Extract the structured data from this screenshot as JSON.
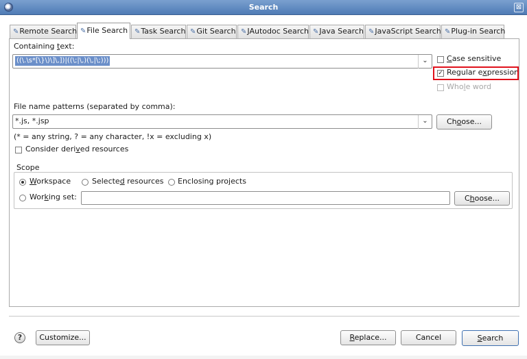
{
  "window": {
    "title": "Search",
    "close_glyph": "⊠"
  },
  "tabs": [
    {
      "label": "Remote Search",
      "icon": "remote-search-icon",
      "active": false
    },
    {
      "label": "File Search",
      "icon": "file-search-icon",
      "active": true
    },
    {
      "label": "Task Search",
      "icon": "task-search-icon",
      "active": false
    },
    {
      "label": "Git Search",
      "icon": "git-search-icon",
      "active": false
    },
    {
      "label": "JAutodoc Search",
      "icon": "jautodoc-search-icon",
      "active": false
    },
    {
      "label": "Java Search",
      "icon": "java-search-icon",
      "active": false
    },
    {
      "label": "JavaScript Search",
      "icon": "javascript-search-icon",
      "active": false
    },
    {
      "label": "Plug-in Search",
      "icon": "plugin-search-icon",
      "active": false
    }
  ],
  "containing": {
    "label_pre": "Containing ",
    "label_mnemonic": "t",
    "label_post": "ext:",
    "value": "((\\.\\s*[\\}\\)\\]\\,])|((\\;|\\,)(\\,|\\;)))"
  },
  "options": {
    "case_sensitive": {
      "pre": "",
      "mnemonic": "C",
      "post": "ase sensitive",
      "checked": false,
      "enabled": true
    },
    "regular_expression": {
      "pre": "Regular e",
      "mnemonic": "x",
      "post": "pression",
      "checked": true,
      "enabled": true
    },
    "whole_word": {
      "pre": "Who",
      "mnemonic": "l",
      "post": "e word",
      "checked": false,
      "enabled": false
    }
  },
  "file_patterns": {
    "label": "File name patterns (separated by comma):",
    "value": "*.js, *.jsp",
    "hint": "(* = any string, ? = any character, !x = excluding x)",
    "choose_pre": "Ch",
    "choose_mnemonic": "o",
    "choose_post": "ose..."
  },
  "derived": {
    "pre": "Consider deri",
    "mnemonic": "v",
    "post": "ed resources",
    "checked": false
  },
  "scope": {
    "legend": "Scope",
    "workspace": {
      "pre": "",
      "mnemonic": "W",
      "post": "orkspace",
      "selected": true
    },
    "selected_resources": {
      "pre": "Selecte",
      "mnemonic": "d",
      "post": " resources",
      "selected": false
    },
    "enclosing_projects": {
      "pre": "Enclosing pro",
      "mnemonic": "j",
      "post": "ects",
      "selected": false
    },
    "working_set": {
      "pre": "Wor",
      "mnemonic": "k",
      "post": "ing set:",
      "selected": false,
      "value": ""
    },
    "choose_pre": "C",
    "choose_mnemonic": "h",
    "choose_post": "oose..."
  },
  "footer": {
    "help_glyph": "?",
    "customize_label": "Customize...",
    "replace_pre": "",
    "replace_mnemonic": "R",
    "replace_post": "eplace...",
    "cancel_label": "Cancel",
    "search_pre": "",
    "search_mnemonic": "S",
    "search_post": "earch"
  },
  "colors": {
    "highlight_box": "#e0101a",
    "selection": "#6b8fc9",
    "titlebar": "#5a84bd"
  }
}
